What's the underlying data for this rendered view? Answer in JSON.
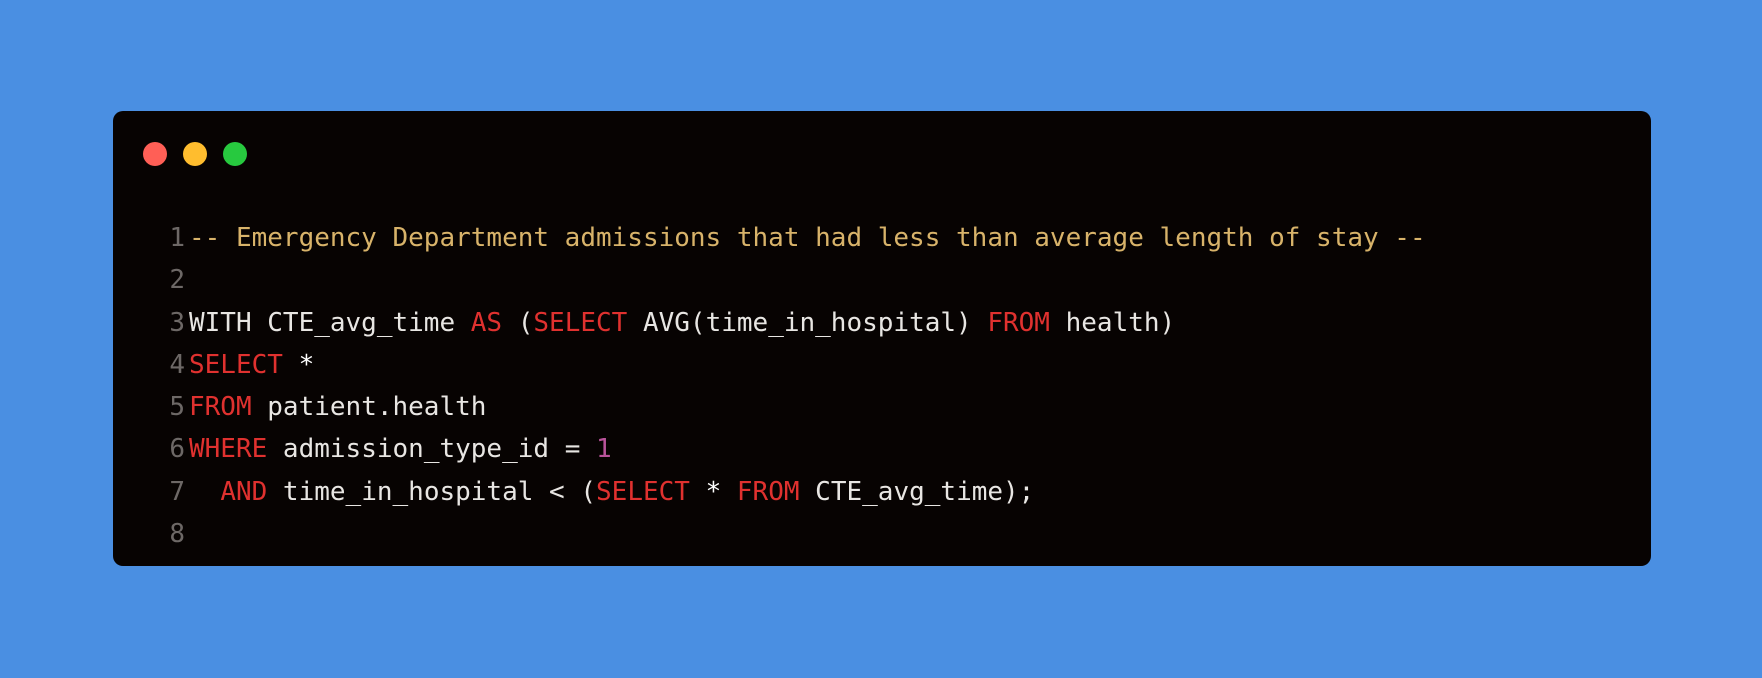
{
  "theme": {
    "background": "#4a8fe2",
    "editor_background": "#070302",
    "line_number_color": "#6d6866",
    "default_text": "#e8e6e3",
    "keyword": "#e0312f",
    "comment": "#d8b36a",
    "number": "#b9539a",
    "operator": "#ffffff"
  },
  "window_controls": [
    {
      "name": "close",
      "color": "#ff5f56"
    },
    {
      "name": "minimize",
      "color": "#ffbd2e"
    },
    {
      "name": "maximize",
      "color": "#27c93f"
    }
  ],
  "code": {
    "language": "sql",
    "lines": [
      {
        "number": "1",
        "tokens": [
          {
            "text": "-- Emergency Department admissions that had less than average length of stay --",
            "type": "comment"
          }
        ]
      },
      {
        "number": "2",
        "tokens": []
      },
      {
        "number": "3",
        "tokens": [
          {
            "text": "WITH CTE_avg_time ",
            "type": "plain"
          },
          {
            "text": "AS",
            "type": "keyword"
          },
          {
            "text": " (",
            "type": "plain"
          },
          {
            "text": "SELECT",
            "type": "keyword"
          },
          {
            "text": " AVG(time_in_hospital) ",
            "type": "plain"
          },
          {
            "text": "FROM",
            "type": "keyword"
          },
          {
            "text": " health)",
            "type": "plain"
          }
        ]
      },
      {
        "number": "4",
        "tokens": [
          {
            "text": "SELECT",
            "type": "keyword"
          },
          {
            "text": " ",
            "type": "plain"
          },
          {
            "text": "*",
            "type": "operator"
          }
        ]
      },
      {
        "number": "5",
        "tokens": [
          {
            "text": "FROM",
            "type": "keyword"
          },
          {
            "text": " patient.health",
            "type": "plain"
          }
        ]
      },
      {
        "number": "6",
        "tokens": [
          {
            "text": "WHERE",
            "type": "keyword"
          },
          {
            "text": " admission_type_id = ",
            "type": "plain"
          },
          {
            "text": "1",
            "type": "number"
          }
        ]
      },
      {
        "number": "7",
        "tokens": [
          {
            "text": "  ",
            "type": "plain"
          },
          {
            "text": "AND",
            "type": "keyword"
          },
          {
            "text": " time_in_hospital < (",
            "type": "plain"
          },
          {
            "text": "SELECT",
            "type": "keyword"
          },
          {
            "text": " ",
            "type": "plain"
          },
          {
            "text": "*",
            "type": "operator"
          },
          {
            "text": " ",
            "type": "plain"
          },
          {
            "text": "FROM",
            "type": "keyword"
          },
          {
            "text": " CTE_avg_time);",
            "type": "plain"
          }
        ]
      },
      {
        "number": "8",
        "tokens": []
      }
    ]
  }
}
